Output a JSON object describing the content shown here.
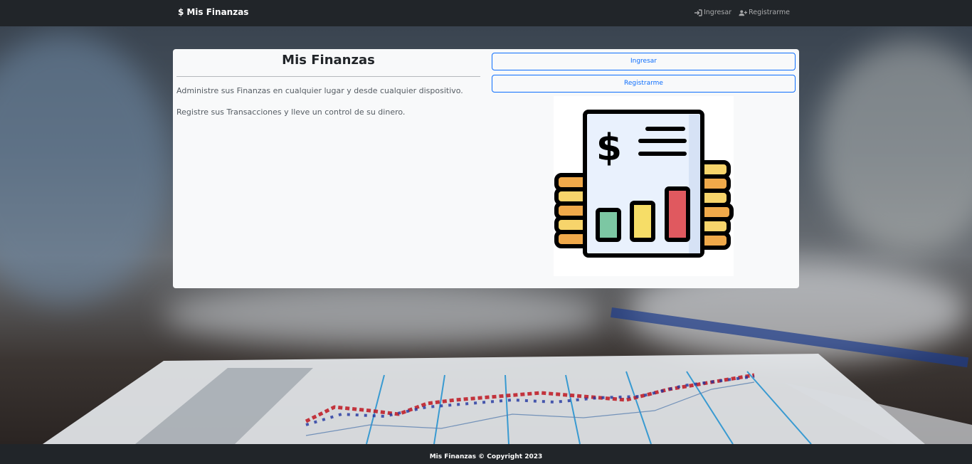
{
  "navbar": {
    "brand": "Mis Finanzas",
    "links": [
      {
        "label": "Ingresar",
        "icon": "sign-in-icon"
      },
      {
        "label": "Registrarme",
        "icon": "user-plus-icon"
      }
    ]
  },
  "card": {
    "title": "Mis Finanzas",
    "paragraphs": [
      "Administre sus Finanzas en cualquier lugar y desde cualquier dispositivo.",
      "Registre sus Transacciones y lleve un control de su dinero."
    ],
    "buttons": {
      "login": "Ingresar",
      "register": "Registrarme"
    }
  },
  "footer": {
    "text": "Mis Finanzas © Copyright 2023"
  },
  "colors": {
    "navbar": "#212529",
    "primary": "#0d6efd",
    "card": "#f8f9fa"
  }
}
